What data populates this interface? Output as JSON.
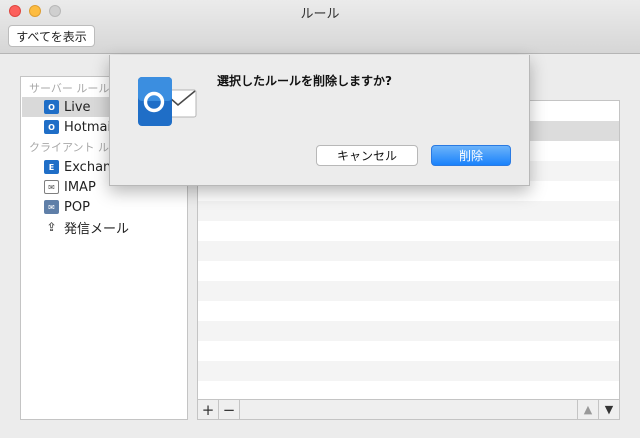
{
  "window": {
    "title": "ルール"
  },
  "toolbar": {
    "show_all_label": "すべてを表示"
  },
  "sidebar": {
    "server_section": "サーバー ルール",
    "client_section": "クライアント ルール",
    "server_accounts": [
      {
        "label": "Live",
        "icon": "outlook-icon",
        "selected": true
      },
      {
        "label": "Hotmail",
        "icon": "outlook-icon",
        "selected": false
      }
    ],
    "client_accounts": [
      {
        "label": "Exchange",
        "icon": "exchange-icon"
      },
      {
        "label": "IMAP",
        "icon": "mail-icon"
      },
      {
        "label": "POP",
        "icon": "pop-icon"
      },
      {
        "label": "発信メール",
        "icon": "outgoing-icon"
      }
    ]
  },
  "rules_list": {
    "add_label": "+",
    "remove_label": "−",
    "move_up_label": "▲",
    "move_down_label": "▼"
  },
  "dialog": {
    "message": "選択したルールを削除しますか?",
    "cancel_label": "キャンセル",
    "delete_label": "削除"
  },
  "colors": {
    "accent": "#1a82fb",
    "outlook_blue": "#1f6ec7"
  }
}
